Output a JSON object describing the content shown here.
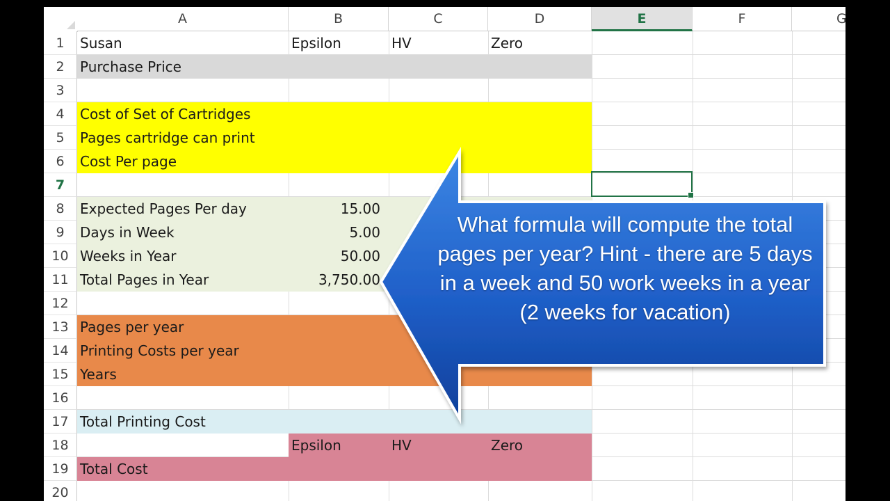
{
  "columns": [
    "A",
    "B",
    "C",
    "D",
    "E",
    "F",
    "G"
  ],
  "selected_column": "E",
  "rows": [
    "1",
    "2",
    "3",
    "4",
    "5",
    "6",
    "7",
    "8",
    "9",
    "10",
    "11",
    "12",
    "13",
    "14",
    "15",
    "16",
    "17",
    "18",
    "19",
    "20"
  ],
  "selected_row": "7",
  "cells": {
    "r1": {
      "a": "Susan",
      "b": "Epsilon",
      "c": "HV",
      "d": "Zero"
    },
    "r2": {
      "a": "Purchase Price"
    },
    "r4": {
      "a": "Cost of Set of Cartridges"
    },
    "r5": {
      "a": "Pages cartridge can print"
    },
    "r6": {
      "a": "Cost Per page"
    },
    "r8": {
      "a": "Expected Pages Per day",
      "b": "15.00"
    },
    "r9": {
      "a": "Days in Week",
      "b": "5.00"
    },
    "r10": {
      "a": "Weeks in Year",
      "b": "50.00"
    },
    "r11": {
      "a": "Total Pages in Year",
      "b": "3,750.00"
    },
    "r13": {
      "a": "Pages per year"
    },
    "r14": {
      "a": "Printing Costs per year"
    },
    "r15": {
      "a": "Years"
    },
    "r17": {
      "a": "Total Printing Cost"
    },
    "r18": {
      "b": "Epsilon",
      "c": "HV",
      "d": "Zero"
    },
    "r19": {
      "a": "Total Cost"
    }
  },
  "active_cell": "E7",
  "fill_colors": {
    "gray": "#d9d9d9",
    "yellow": "#ffff00",
    "light_green": "#ebf1de",
    "orange": "#e8894a",
    "light_blue": "#daeef3",
    "pink": "#d88495",
    "accent_green": "#217346"
  },
  "callout": {
    "text": "What formula will compute the total pages per year? Hint - there are 5 days in a week and 50 work weeks in a year (2 weeks for vacation)",
    "color": "#1f5fc8"
  }
}
